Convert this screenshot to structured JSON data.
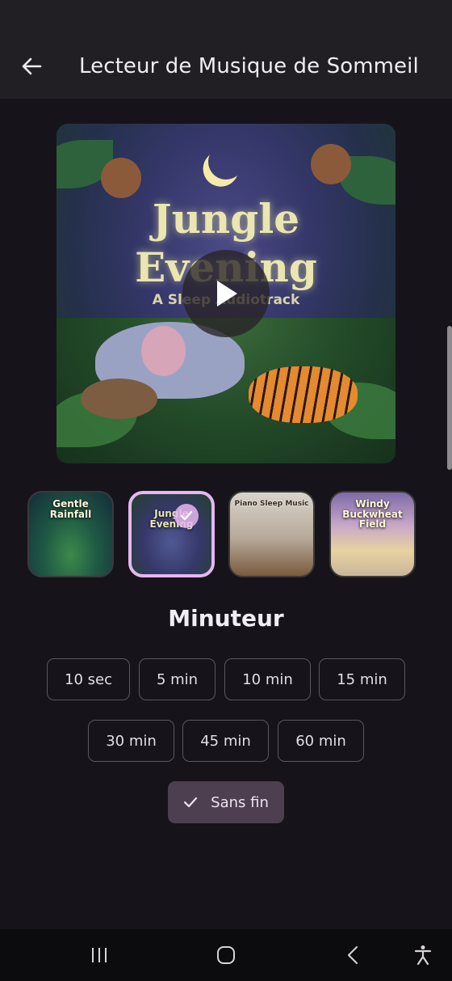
{
  "app_bar": {
    "title": "Lecteur de Musique de Sommeil",
    "back_icon": "arrow-left-icon"
  },
  "now_playing": {
    "cover_title_line1": "Jungle",
    "cover_title_line2": "Evening",
    "cover_subtitle": "A Sleep Audiotrack",
    "play_icon": "play-icon"
  },
  "tracks": [
    {
      "label": "Gentle\nRainfall",
      "selected": false
    },
    {
      "label": "Jungle\nEvening",
      "selected": true
    },
    {
      "label": "Piano Sleep Music",
      "selected": false
    },
    {
      "label": "Windy\nBuckwheat\nField",
      "selected": false
    }
  ],
  "timer": {
    "title": "Minuteur",
    "options": [
      "10 sec",
      "5 min",
      "10 min",
      "15 min",
      "30 min",
      "45 min",
      "60 min"
    ],
    "selected_option": "Sans fin"
  },
  "nav": {
    "recents_icon": "recents-icon",
    "home_icon": "home-icon",
    "back_icon": "back-chevron-icon",
    "accessibility_icon": "accessibility-icon"
  },
  "colors": {
    "background": "#16141a",
    "app_bar": "#211f23",
    "accent": "#e6b7f0",
    "selected_chip": "#4d3f50"
  }
}
